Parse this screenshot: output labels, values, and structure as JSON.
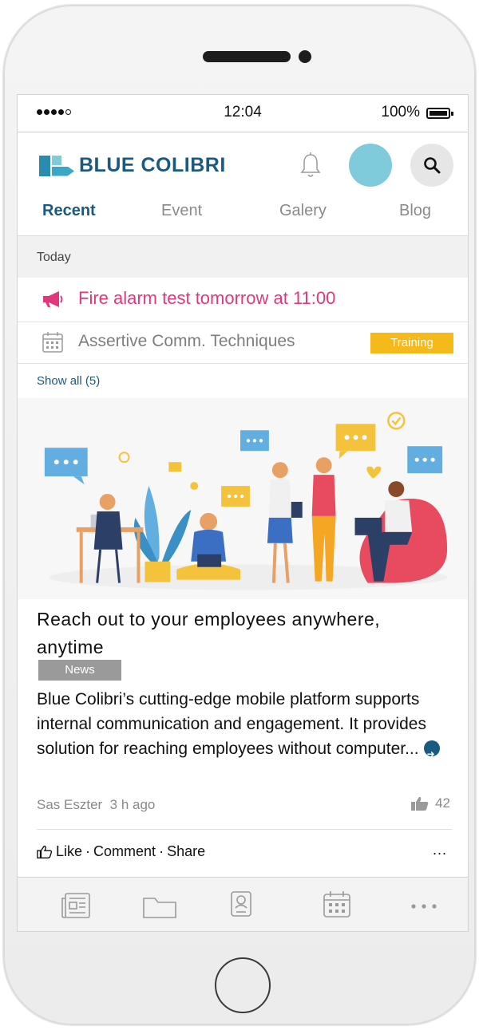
{
  "status_bar": {
    "time": "12:04",
    "battery": "100%"
  },
  "brand": {
    "name": "BLUE COLIBRI"
  },
  "tabs": [
    {
      "label": "Recent",
      "active": true
    },
    {
      "label": "Event",
      "active": false
    },
    {
      "label": "Galery",
      "active": false
    },
    {
      "label": "Blog",
      "active": false
    }
  ],
  "section_header": "Today",
  "alert": {
    "text": "Fire alarm test tomorrow at 11:00",
    "icon": "megaphone-icon",
    "color": "#e2377b"
  },
  "event": {
    "title": "Assertive Comm. Techniques",
    "badge": "Training",
    "icon": "calendar-icon"
  },
  "show_all": "Show all (5)",
  "post": {
    "title": "Reach out to your employees anywhere, anytime",
    "badge": "News",
    "body": "Blue Colibri’s cutting-edge mobile platform supports internal communication and engagement. It provides solution for reaching employees without computer...",
    "author": "Sas Eszter",
    "time": "3 h ago",
    "likes": "42",
    "actions": {
      "like": "Like",
      "comment": "Comment",
      "share": "Share",
      "sep": "·",
      "more": "..."
    }
  },
  "bottom_nav": [
    "news-icon",
    "folder-icon",
    "profile-card-icon",
    "calendar-icon",
    "more-icon"
  ],
  "colors": {
    "brand": "#1b5a80",
    "accent_pink": "#e2377b",
    "badge_training": "#f6b91a",
    "badge_news": "#9a9a9a",
    "avatar": "#80cbdb"
  }
}
